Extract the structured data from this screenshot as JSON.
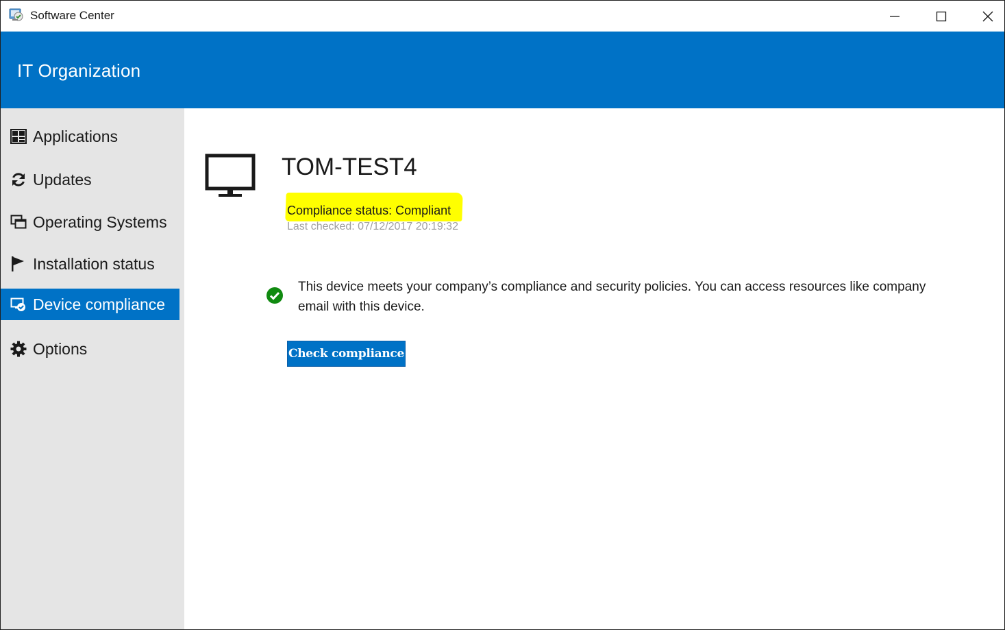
{
  "window": {
    "title": "Software Center",
    "controls": [
      "minimize",
      "maximize",
      "close"
    ]
  },
  "header": {
    "organization": "IT Organization"
  },
  "sidebar": {
    "items": [
      {
        "label": "Applications",
        "icon": "applications-icon",
        "active": false
      },
      {
        "label": "Updates",
        "icon": "refresh-icon",
        "active": false
      },
      {
        "label": "Operating Systems",
        "icon": "operating-systems-icon",
        "active": false
      },
      {
        "label": "Installation status",
        "icon": "flag-icon",
        "active": false
      },
      {
        "label": "Device compliance",
        "icon": "device-compliance-icon",
        "active": true
      },
      {
        "label": "Options",
        "icon": "gear-icon",
        "active": false
      }
    ]
  },
  "device": {
    "name": "TOM-TEST4",
    "icon": "monitor-icon",
    "compliance_status": "Compliance status: Compliant",
    "last_checked": "Last checked: 07/12/2017 20:19:32",
    "message": "This device meets your company’s compliance and security policies. You can access resources like company email with this device.",
    "status_icon": "check-circle-icon",
    "check_button": "Check compliance"
  },
  "colors": {
    "accent": "#0072c6",
    "sidebar_bg": "#e5e5e5",
    "highlight": "#ffff00",
    "success": "#108a10"
  }
}
